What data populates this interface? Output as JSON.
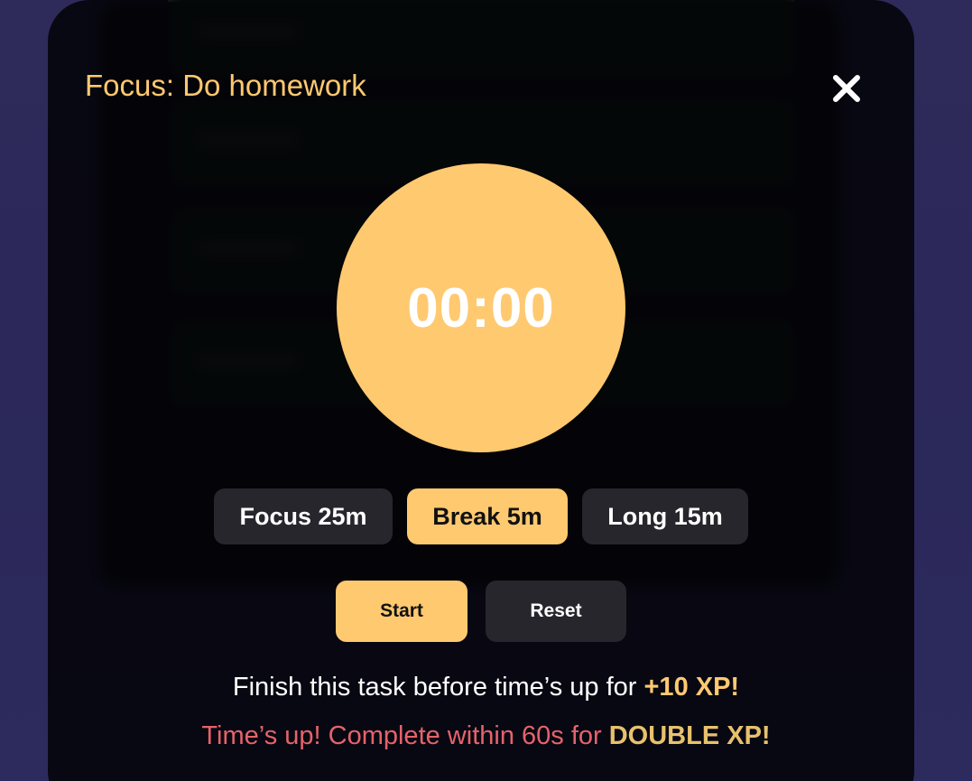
{
  "modal": {
    "title": "Focus: Do homework",
    "close_icon": "close-x-icon"
  },
  "timer": {
    "display": "00:00"
  },
  "modes": [
    {
      "label": "Focus 25m",
      "active": false
    },
    {
      "label": "Break 5m",
      "active": true
    },
    {
      "label": "Long 15m",
      "active": false
    }
  ],
  "actions": {
    "start_label": "Start",
    "reset_label": "Reset"
  },
  "messages": {
    "finish_prefix": "Finish this task before time’s up for ",
    "finish_reward": "+10 XP!",
    "timeup_prefix": "Time’s up! Complete within 60s for ",
    "timeup_reward": "DOUBLE XP!"
  },
  "colors": {
    "accent": "#ffc970",
    "warning": "#e5636b",
    "button_dark": "#26262c"
  }
}
